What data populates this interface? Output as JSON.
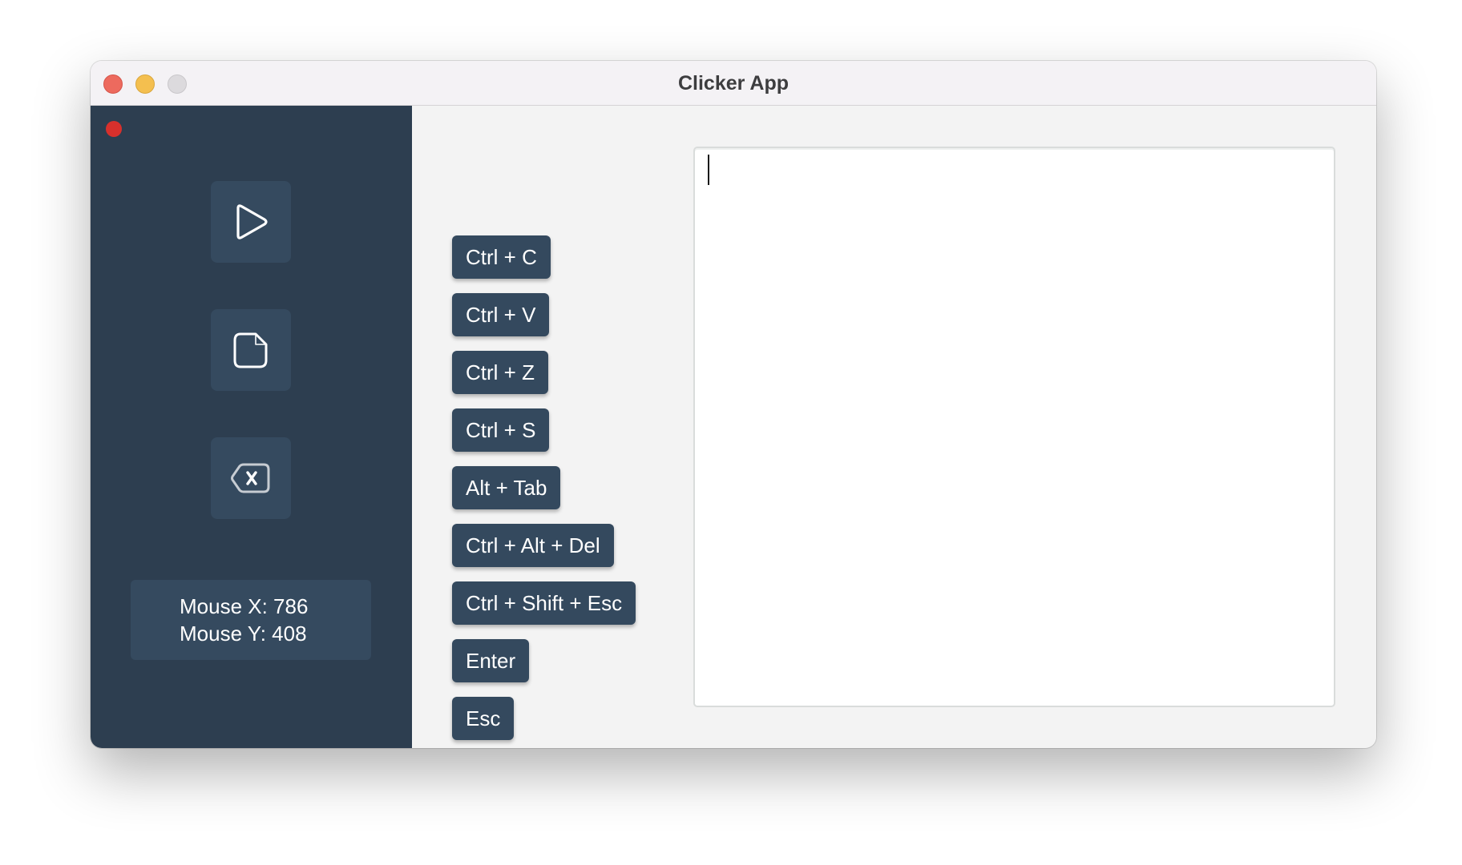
{
  "window": {
    "title": "Clicker App"
  },
  "sidebar": {
    "buttons": [
      {
        "name": "play",
        "icon": "play-icon"
      },
      {
        "name": "file",
        "icon": "file-icon"
      },
      {
        "name": "clear",
        "icon": "backspace-icon"
      }
    ],
    "record_indicator_color": "#d8302c",
    "mouse": {
      "x_label": "Mouse X: 786",
      "y_label": "Mouse Y: 408"
    }
  },
  "shortcuts": [
    "Ctrl + C",
    "Ctrl + V",
    "Ctrl + Z",
    "Ctrl + S",
    "Alt + Tab",
    "Ctrl + Alt + Del",
    "Ctrl + Shift + Esc",
    "Enter",
    "Esc"
  ],
  "editor": {
    "value": ""
  },
  "colors": {
    "sidebar_bg": "#2d3e50",
    "button_bg": "#34495e",
    "content_bg": "#f3f3f3"
  }
}
